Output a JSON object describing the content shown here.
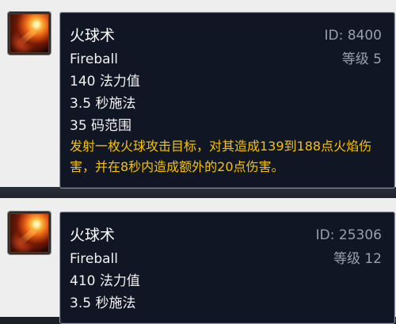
{
  "cards": [
    {
      "icon": "fireball-icon",
      "name": "火球术",
      "id_text": "ID: 8400",
      "english_name": "Fireball",
      "rank_text": "等级 5",
      "mana": "140 法力值",
      "cast": "3.5 秒施法",
      "range": "35 码范围",
      "description": "发射一枚火球攻击目标，对其造成139到188点火焰伤害，并在8秒内造成额外的20点伤害。"
    },
    {
      "icon": "fireball-icon",
      "name": "火球术",
      "id_text": "ID: 25306",
      "english_name": "Fireball",
      "rank_text": "等级 12",
      "mana": "410 法力值",
      "cast": "3.5 秒施法"
    }
  ],
  "colors": {
    "tooltip_background": "#111625",
    "tooltip_border": "#8f96a6",
    "description_text": "#f5c200",
    "secondary_text": "#9aa0ab"
  }
}
